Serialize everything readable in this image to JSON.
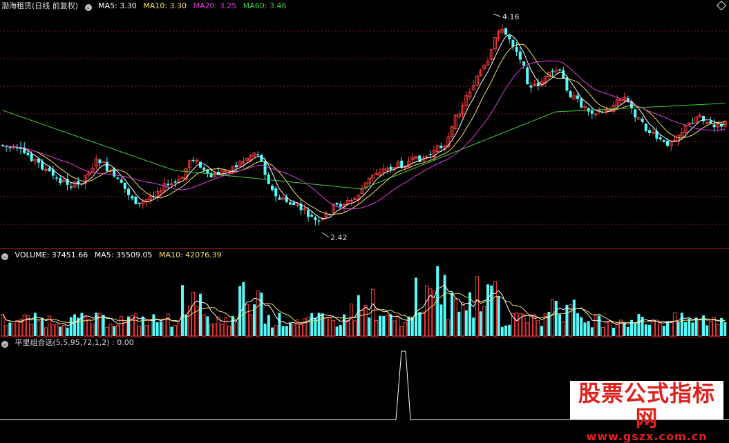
{
  "main_header": {
    "title": "渤海租赁(日线 前复权)",
    "indicators": [
      {
        "label": "MA5: 3.30",
        "color": "#ffffff"
      },
      {
        "label": "MA10: 3.30",
        "color": "#f5e16b"
      },
      {
        "label": "MA20: 3.25",
        "color": "#e040e0"
      },
      {
        "label": "MA60: 3.46",
        "color": "#40d040"
      }
    ]
  },
  "main_annotations": {
    "high_label": "4.16",
    "low_label": "2.42"
  },
  "volume_header": {
    "items": [
      {
        "label": "VOLUME: 37451.66",
        "color": "#ffffff"
      },
      {
        "label": "MA5: 35509.05",
        "color": "#ffffff"
      },
      {
        "label": "MA10: 42076.39",
        "color": "#f5e16b"
      }
    ]
  },
  "indicator_header": {
    "label": "平里组合选(5,5,95,72,1,2) : 0.00"
  },
  "watermark": {
    "title": "股票公式指标网",
    "url": "www.gszx.com.cn"
  },
  "colors": {
    "up": "#ff3c3c",
    "down": "#54fcfc",
    "ma5": "#ffffff",
    "ma10": "#f5e16b",
    "ma20": "#e040e0",
    "ma60": "#40d040",
    "grid": "#8a1a1a"
  }
}
